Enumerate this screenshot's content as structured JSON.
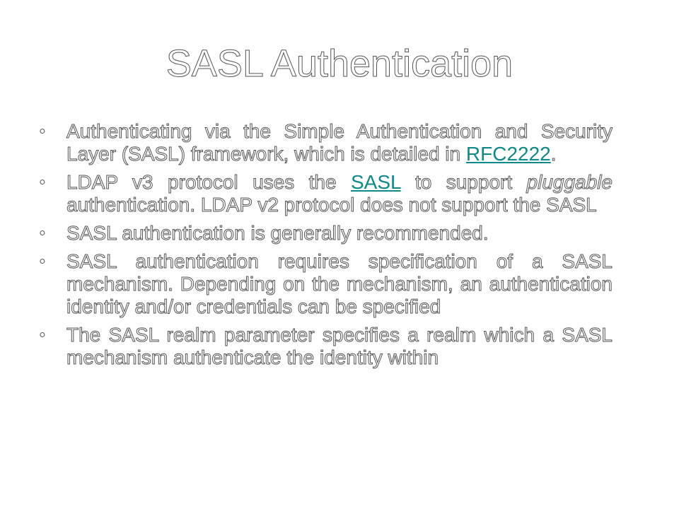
{
  "slide": {
    "title": "SASL Authentication",
    "bullets": [
      {
        "pre": "Authenticating via the Simple Authentication and Security Layer (SASL) framework, which is detailed in ",
        "link": "RFC2222",
        "post": "."
      },
      {
        "pre": "LDAP v3 protocol uses the ",
        "link": "SASL",
        "mid": " to support ",
        "italic": "pluggable",
        "post": " authentication.  LDAP v2 protocol does not support the SASL"
      },
      {
        "text": "SASL authentication is generally recommended."
      },
      {
        "text": "SASL authentication requires specification of a SASL mechanism. Depending on the mechanism, an authentication identity and/or credentials can be specified"
      },
      {
        "text": "The SASL realm parameter specifies a realm which a SASL mechanism authenticate the identity within"
      }
    ],
    "bullet_glyph": "•",
    "link_color": "#0e8a8a"
  }
}
